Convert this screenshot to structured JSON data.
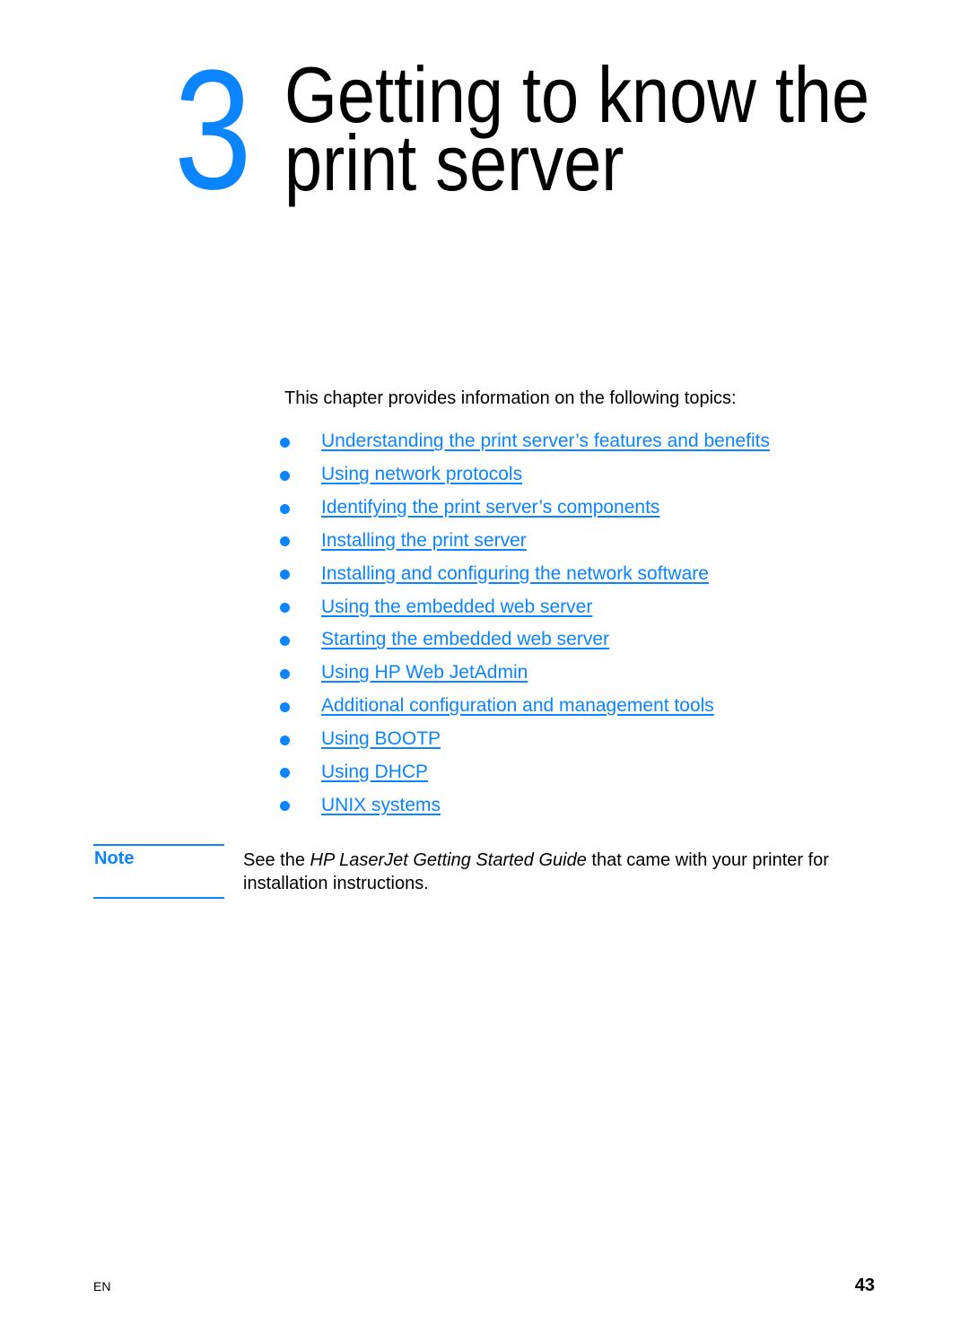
{
  "chapter": {
    "number": "3",
    "title_line1": "Getting to know the",
    "title_line2": "print server"
  },
  "intro": "This chapter provides information on the following topics:",
  "topics": [
    {
      "label": "Understanding the print server’s features and benefits"
    },
    {
      "label": "Using network protocols"
    },
    {
      "label": "Identifying the print server’s components"
    },
    {
      "label": "Installing the print server"
    },
    {
      "label": "Installing and configuring the network software"
    },
    {
      "label": "Using the embedded web server"
    },
    {
      "label": "Starting the embedded web server"
    },
    {
      "label": "Using HP Web JetAdmin"
    },
    {
      "label": "Additional configuration and management tools"
    },
    {
      "label": "Using BOOTP"
    },
    {
      "label": "Using DHCP"
    },
    {
      "label": "UNIX systems"
    }
  ],
  "note": {
    "label": "Note",
    "text_before": "See the ",
    "text_italic": "HP LaserJet Getting Started Guide",
    "text_after": " that came with your printer for installation instructions."
  },
  "footer": {
    "left": "EN",
    "page_number": "43"
  },
  "colors": {
    "accent": "#0a84ff",
    "text": "#000000"
  }
}
